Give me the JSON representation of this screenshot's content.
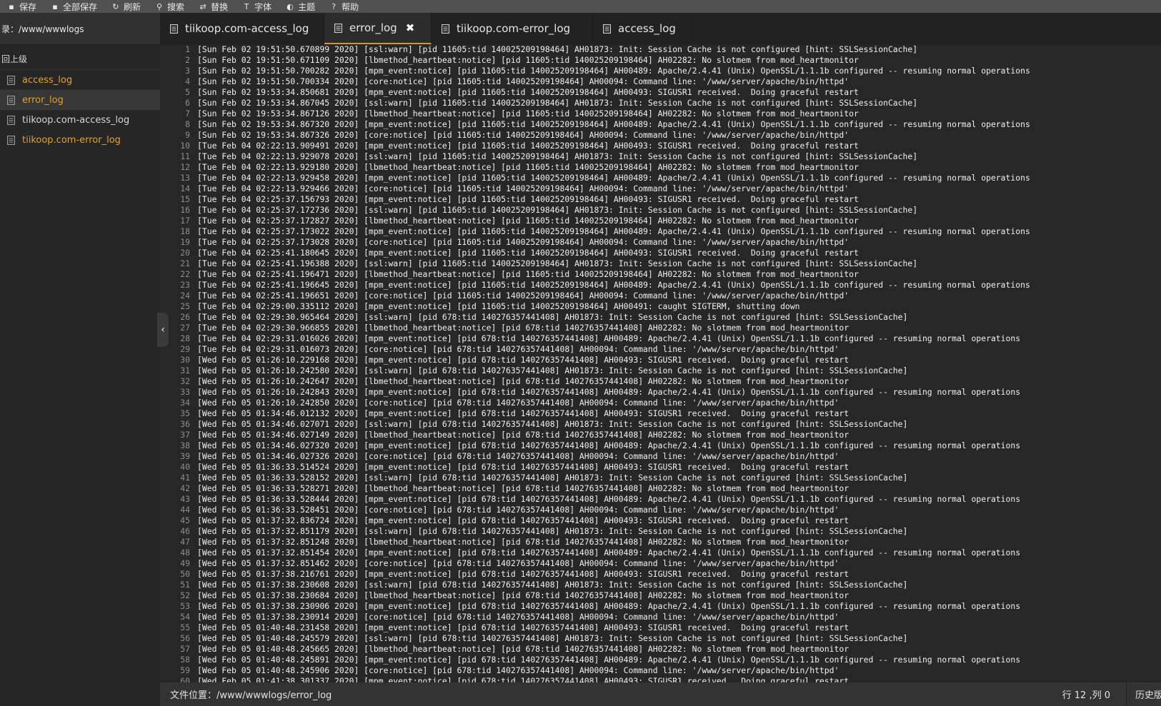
{
  "toolbar": {
    "buttons": [
      {
        "label": "保存",
        "icon": "save-icon",
        "glyph": "▪"
      },
      {
        "label": "全部保存",
        "icon": "save-all-icon",
        "glyph": "▪"
      },
      {
        "label": "刷新",
        "icon": "refresh-icon",
        "glyph": "↻"
      },
      {
        "label": "搜索",
        "icon": "search-icon",
        "glyph": "⚲"
      },
      {
        "label": "替换",
        "icon": "replace-icon",
        "glyph": "⇄"
      },
      {
        "label": "字体",
        "icon": "font-icon",
        "glyph": "T"
      },
      {
        "label": "主题",
        "icon": "theme-icon",
        "glyph": "◐"
      },
      {
        "label": "帮助",
        "icon": "help-icon",
        "glyph": "?"
      }
    ]
  },
  "sidebar": {
    "path": "录：/www/wwwlogs",
    "up_label": "回上级",
    "files": [
      {
        "name": "access_log",
        "color": "yellow",
        "selected": false
      },
      {
        "name": "error_log",
        "color": "yellow",
        "selected": true
      },
      {
        "name": "tiikoop.com-access_log",
        "color": "white",
        "selected": false
      },
      {
        "name": "tiikoop.com-error_log",
        "color": "yellow",
        "selected": false
      }
    ],
    "collapse_glyph": "‹"
  },
  "tabs": [
    {
      "label": "tiikoop.com-access_log",
      "active": false
    },
    {
      "label": "error_log",
      "active": true,
      "close": "✖"
    },
    {
      "label": "tiikoop.com-error_log",
      "active": false
    },
    {
      "label": "access_log",
      "active": false
    }
  ],
  "editor": {
    "lines": [
      "[Sun Feb 02 19:51:50.670899 2020] [ssl:warn] [pid 11605:tid 140025209198464] AH01873: Init: Session Cache is not configured [hint: SSLSessionCache]",
      "[Sun Feb 02 19:51:50.671109 2020] [lbmethod_heartbeat:notice] [pid 11605:tid 140025209198464] AH02282: No slotmem from mod_heartmonitor",
      "[Sun Feb 02 19:51:50.700282 2020] [mpm_event:notice] [pid 11605:tid 140025209198464] AH00489: Apache/2.4.41 (Unix) OpenSSL/1.1.1b configured -- resuming normal operations",
      "[Sun Feb 02 19:51:50.700334 2020] [core:notice] [pid 11605:tid 140025209198464] AH00094: Command line: '/www/server/apache/bin/httpd'",
      "[Sun Feb 02 19:53:34.850681 2020] [mpm_event:notice] [pid 11605:tid 140025209198464] AH00493: SIGUSR1 received.  Doing graceful restart",
      "[Sun Feb 02 19:53:34.867045 2020] [ssl:warn] [pid 11605:tid 140025209198464] AH01873: Init: Session Cache is not configured [hint: SSLSessionCache]",
      "[Sun Feb 02 19:53:34.867126 2020] [lbmethod_heartbeat:notice] [pid 11605:tid 140025209198464] AH02282: No slotmem from mod_heartmonitor",
      "[Sun Feb 02 19:53:34.867320 2020] [mpm_event:notice] [pid 11605:tid 140025209198464] AH00489: Apache/2.4.41 (Unix) OpenSSL/1.1.1b configured -- resuming normal operations",
      "[Sun Feb 02 19:53:34.867326 2020] [core:notice] [pid 11605:tid 140025209198464] AH00094: Command line: '/www/server/apache/bin/httpd'",
      "[Tue Feb 04 02:22:13.909491 2020] [mpm_event:notice] [pid 11605:tid 140025209198464] AH00493: SIGUSR1 received.  Doing graceful restart",
      "[Tue Feb 04 02:22:13.929078 2020] [ssl:warn] [pid 11605:tid 140025209198464] AH01873: Init: Session Cache is not configured [hint: SSLSessionCache]",
      "[Tue Feb 04 02:22:13.929180 2020] [lbmethod_heartbeat:notice] [pid 11605:tid 140025209198464] AH02282: No slotmem from mod_heartmonitor",
      "[Tue Feb 04 02:22:13.929458 2020] [mpm_event:notice] [pid 11605:tid 140025209198464] AH00489: Apache/2.4.41 (Unix) OpenSSL/1.1.1b configured -- resuming normal operations",
      "[Tue Feb 04 02:22:13.929466 2020] [core:notice] [pid 11605:tid 140025209198464] AH00094: Command line: '/www/server/apache/bin/httpd'",
      "[Tue Feb 04 02:25:37.156793 2020] [mpm_event:notice] [pid 11605:tid 140025209198464] AH00493: SIGUSR1 received.  Doing graceful restart",
      "[Tue Feb 04 02:25:37.172736 2020] [ssl:warn] [pid 11605:tid 140025209198464] AH01873: Init: Session Cache is not configured [hint: SSLSessionCache]",
      "[Tue Feb 04 02:25:37.172827 2020] [lbmethod_heartbeat:notice] [pid 11605:tid 140025209198464] AH02282: No slotmem from mod_heartmonitor",
      "[Tue Feb 04 02:25:37.173022 2020] [mpm_event:notice] [pid 11605:tid 140025209198464] AH00489: Apache/2.4.41 (Unix) OpenSSL/1.1.1b configured -- resuming normal operations",
      "[Tue Feb 04 02:25:37.173028 2020] [core:notice] [pid 11605:tid 140025209198464] AH00094: Command line: '/www/server/apache/bin/httpd'",
      "[Tue Feb 04 02:25:41.180645 2020] [mpm_event:notice] [pid 11605:tid 140025209198464] AH00493: SIGUSR1 received.  Doing graceful restart",
      "[Tue Feb 04 02:25:41.196388 2020] [ssl:warn] [pid 11605:tid 140025209198464] AH01873: Init: Session Cache is not configured [hint: SSLSessionCache]",
      "[Tue Feb 04 02:25:41.196471 2020] [lbmethod_heartbeat:notice] [pid 11605:tid 140025209198464] AH02282: No slotmem from mod_heartmonitor",
      "[Tue Feb 04 02:25:41.196645 2020] [mpm_event:notice] [pid 11605:tid 140025209198464] AH00489: Apache/2.4.41 (Unix) OpenSSL/1.1.1b configured -- resuming normal operations",
      "[Tue Feb 04 02:25:41.196651 2020] [core:notice] [pid 11605:tid 140025209198464] AH00094: Command line: '/www/server/apache/bin/httpd'",
      "[Tue Feb 04 02:29:00.335112 2020] [mpm_event:notice] [pid 11605:tid 140025209198464] AH00491: caught SIGTERM, shutting down",
      "[Tue Feb 04 02:29:30.965464 2020] [ssl:warn] [pid 678:tid 140276357441408] AH01873: Init: Session Cache is not configured [hint: SSLSessionCache]",
      "[Tue Feb 04 02:29:30.966855 2020] [lbmethod_heartbeat:notice] [pid 678:tid 140276357441408] AH02282: No slotmem from mod_heartmonitor",
      "[Tue Feb 04 02:29:31.016026 2020] [mpm_event:notice] [pid 678:tid 140276357441408] AH00489: Apache/2.4.41 (Unix) OpenSSL/1.1.1b configured -- resuming normal operations",
      "[Tue Feb 04 02:29:31.016073 2020] [core:notice] [pid 678:tid 140276357441408] AH00094: Command line: '/www/server/apache/bin/httpd'",
      "[Wed Feb 05 01:26:10.229168 2020] [mpm_event:notice] [pid 678:tid 140276357441408] AH00493: SIGUSR1 received.  Doing graceful restart",
      "[Wed Feb 05 01:26:10.242580 2020] [ssl:warn] [pid 678:tid 140276357441408] AH01873: Init: Session Cache is not configured [hint: SSLSessionCache]",
      "[Wed Feb 05 01:26:10.242647 2020] [lbmethod_heartbeat:notice] [pid 678:tid 140276357441408] AH02282: No slotmem from mod_heartmonitor",
      "[Wed Feb 05 01:26:10.242843 2020] [mpm_event:notice] [pid 678:tid 140276357441408] AH00489: Apache/2.4.41 (Unix) OpenSSL/1.1.1b configured -- resuming normal operations",
      "[Wed Feb 05 01:26:10.242850 2020] [core:notice] [pid 678:tid 140276357441408] AH00094: Command line: '/www/server/apache/bin/httpd'",
      "[Wed Feb 05 01:34:46.012132 2020] [mpm_event:notice] [pid 678:tid 140276357441408] AH00493: SIGUSR1 received.  Doing graceful restart",
      "[Wed Feb 05 01:34:46.027071 2020] [ssl:warn] [pid 678:tid 140276357441408] AH01873: Init: Session Cache is not configured [hint: SSLSessionCache]",
      "[Wed Feb 05 01:34:46.027149 2020] [lbmethod_heartbeat:notice] [pid 678:tid 140276357441408] AH02282: No slotmem from mod_heartmonitor",
      "[Wed Feb 05 01:34:46.027320 2020] [mpm_event:notice] [pid 678:tid 140276357441408] AH00489: Apache/2.4.41 (Unix) OpenSSL/1.1.1b configured -- resuming normal operations",
      "[Wed Feb 05 01:34:46.027326 2020] [core:notice] [pid 678:tid 140276357441408] AH00094: Command line: '/www/server/apache/bin/httpd'",
      "[Wed Feb 05 01:36:33.514524 2020] [mpm_event:notice] [pid 678:tid 140276357441408] AH00493: SIGUSR1 received.  Doing graceful restart",
      "[Wed Feb 05 01:36:33.528152 2020] [ssl:warn] [pid 678:tid 140276357441408] AH01873: Init: Session Cache is not configured [hint: SSLSessionCache]",
      "[Wed Feb 05 01:36:33.528271 2020] [lbmethod_heartbeat:notice] [pid 678:tid 140276357441408] AH02282: No slotmem from mod_heartmonitor",
      "[Wed Feb 05 01:36:33.528444 2020] [mpm_event:notice] [pid 678:tid 140276357441408] AH00489: Apache/2.4.41 (Unix) OpenSSL/1.1.1b configured -- resuming normal operations",
      "[Wed Feb 05 01:36:33.528451 2020] [core:notice] [pid 678:tid 140276357441408] AH00094: Command line: '/www/server/apache/bin/httpd'",
      "[Wed Feb 05 01:37:32.836724 2020] [mpm_event:notice] [pid 678:tid 140276357441408] AH00493: SIGUSR1 received.  Doing graceful restart",
      "[Wed Feb 05 01:37:32.851179 2020] [ssl:warn] [pid 678:tid 140276357441408] AH01873: Init: Session Cache is not configured [hint: SSLSessionCache]",
      "[Wed Feb 05 01:37:32.851248 2020] [lbmethod_heartbeat:notice] [pid 678:tid 140276357441408] AH02282: No slotmem from mod_heartmonitor",
      "[Wed Feb 05 01:37:32.851454 2020] [mpm_event:notice] [pid 678:tid 140276357441408] AH00489: Apache/2.4.41 (Unix) OpenSSL/1.1.1b configured -- resuming normal operations",
      "[Wed Feb 05 01:37:32.851462 2020] [core:notice] [pid 678:tid 140276357441408] AH00094: Command line: '/www/server/apache/bin/httpd'",
      "[Wed Feb 05 01:37:38.216761 2020] [mpm_event:notice] [pid 678:tid 140276357441408] AH00493: SIGUSR1 received.  Doing graceful restart",
      "[Wed Feb 05 01:37:38.230608 2020] [ssl:warn] [pid 678:tid 140276357441408] AH01873: Init: Session Cache is not configured [hint: SSLSessionCache]",
      "[Wed Feb 05 01:37:38.230684 2020] [lbmethod_heartbeat:notice] [pid 678:tid 140276357441408] AH02282: No slotmem from mod_heartmonitor",
      "[Wed Feb 05 01:37:38.230906 2020] [mpm_event:notice] [pid 678:tid 140276357441408] AH00489: Apache/2.4.41 (Unix) OpenSSL/1.1.1b configured -- resuming normal operations",
      "[Wed Feb 05 01:37:38.230914 2020] [core:notice] [pid 678:tid 140276357441408] AH00094: Command line: '/www/server/apache/bin/httpd'",
      "[Wed Feb 05 01:40:48.231458 2020] [mpm_event:notice] [pid 678:tid 140276357441408] AH00493: SIGUSR1 received.  Doing graceful restart",
      "[Wed Feb 05 01:40:48.245579 2020] [ssl:warn] [pid 678:tid 140276357441408] AH01873: Init: Session Cache is not configured [hint: SSLSessionCache]",
      "[Wed Feb 05 01:40:48.245665 2020] [lbmethod_heartbeat:notice] [pid 678:tid 140276357441408] AH02282: No slotmem from mod_heartmonitor",
      "[Wed Feb 05 01:40:48.245891 2020] [mpm_event:notice] [pid 678:tid 140276357441408] AH00489: Apache/2.4.41 (Unix) OpenSSL/1.1.1b configured -- resuming normal operations",
      "[Wed Feb 05 01:40:48.245906 2020] [core:notice] [pid 678:tid 140276357441408] AH00094: Command line: '/www/server/apache/bin/httpd'",
      "[Wed Feb 05 01:41:38.301337 2020] [mpm_event:notice] [pid 678:tid 140276357441408] AH00493: SIGUSR1 received.  Doing graceful restart"
    ]
  },
  "statusbar": {
    "path": "文件位置：/www/wwwlogs/error_log",
    "cursor": "行 12 ,列 0",
    "history": "历史版本"
  },
  "colors": {
    "accent": "#d49b2a",
    "file_yellow": "#e0a230",
    "file_white": "#d6d6d6"
  }
}
